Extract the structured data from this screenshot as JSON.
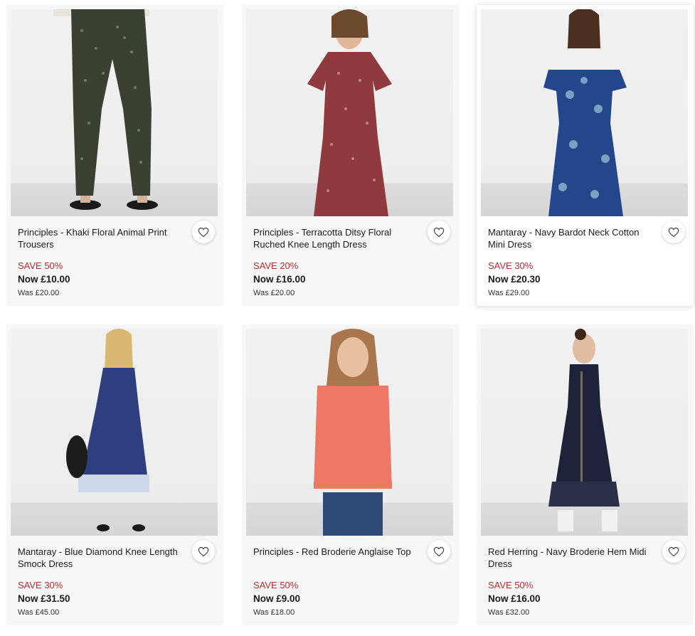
{
  "products": [
    {
      "name": "Principles - Khaki Floral Animal Print Trousers",
      "save": "SAVE 50%",
      "now": "Now £10.00",
      "was": "Was £20.00",
      "image_icon": "product-photo-trousers"
    },
    {
      "name": "Principles - Terracotta Ditsy Floral Ruched Knee Length Dress",
      "save": "SAVE 20%",
      "now": "Now £16.00",
      "was": "Was £20.00",
      "image_icon": "product-photo-dress"
    },
    {
      "name": "Mantaray - Navy Bardot Neck Cotton Mini Dress",
      "save": "SAVE 30%",
      "now": "Now £20.30",
      "was": "Was £29.00",
      "image_icon": "product-photo-dress"
    },
    {
      "name": "Mantaray - Blue Diamond Knee Length Smock Dress",
      "save": "SAVE 30%",
      "now": "Now £31.50",
      "was": "Was £45.00",
      "image_icon": "product-photo-dress"
    },
    {
      "name": "Principles - Red Broderie Anglaise Top",
      "save": "SAVE 50%",
      "now": "Now £9.00",
      "was": "Was £18.00",
      "image_icon": "product-photo-top"
    },
    {
      "name": "Red Herring - Navy Broderie Hem Midi Dress",
      "save": "SAVE 50%",
      "now": "Now £16.00",
      "was": "Was £32.00",
      "image_icon": "product-photo-dress"
    }
  ],
  "wishlist_icon": "heart-outline-icon",
  "colors": {
    "save": "#c0292f",
    "card": "#f7f7f7"
  }
}
